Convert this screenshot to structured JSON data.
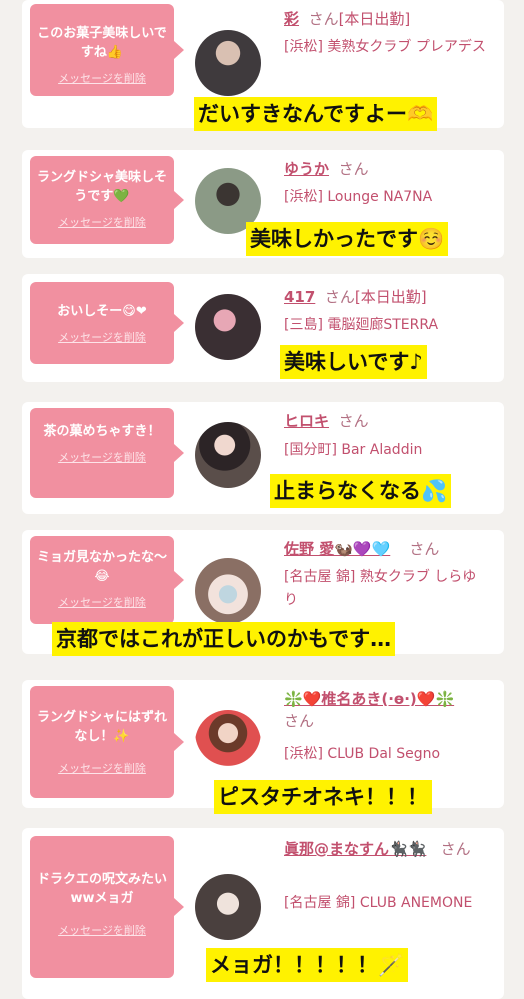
{
  "delete_label": "メッセージを削除",
  "san": "さん",
  "items": [
    {
      "message": "このお菓子美味しいですね👍",
      "name": "彩",
      "status": "[本日出勤]",
      "shop": "[浜松] 美熟女クラブ プレアデス",
      "caption": "だいすきなんですよー🫶",
      "avatar_color": "#3f3a3d"
    },
    {
      "message": "ラングドシャ美味しそうです💚",
      "name": "ゆうか",
      "status": "",
      "shop": "[浜松] Lounge NA7NA",
      "caption": "美味しかったです☺️",
      "avatar_color": "#8b9a86"
    },
    {
      "message": "おいしそー😋❤",
      "name": "417",
      "status": "[本日出勤]",
      "shop": "[三島] 電脳廻廊STERRA",
      "caption": "美味しいです♪",
      "avatar_color": "#3a2f33"
    },
    {
      "message": "茶の菓めちゃすき！",
      "name": "ヒロキ",
      "status": "",
      "shop": "[国分町] Bar Aladdin",
      "caption": "止まらなくなる💦",
      "avatar_color": "#5a4e4a"
    },
    {
      "message": "ミョガ見なかったな～😂",
      "name": "佐野 愛🦦💜🩵",
      "status": "",
      "shop": "[名古屋 錦] 熟女クラブ しらゆり",
      "caption": "京都ではこれが正しいのかもです…",
      "avatar_color": "#d8c9c4"
    },
    {
      "message": "ラングドシャにはずれなし！✨",
      "name": "❇️❤️椎名あき(·ө·)❤️❇️",
      "status": "",
      "shop": "[浜松] CLUB Dal Segno",
      "caption": "ピスタチオネキ！！！",
      "avatar_color": "#e8a9a4"
    },
    {
      "message": "ドラクエの呪文みたいwwメョガ",
      "name": "眞那@まなすん🐈‍⬛🐈‍⬛",
      "status": "",
      "shop": "[名古屋 錦] CLUB ANEMONE",
      "caption": "メョガ！！！！！🪄",
      "avatar_color": "#4a403e"
    }
  ]
}
